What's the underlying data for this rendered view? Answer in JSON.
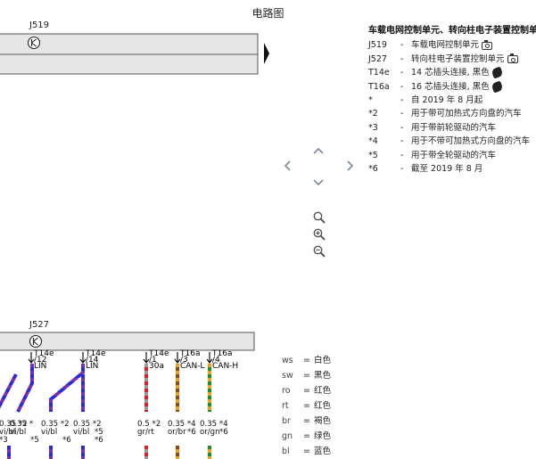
{
  "header": {
    "title": "电路图"
  },
  "legend": {
    "title": "车载电网控制单元、转向柱电子装置控制单元",
    "rows": [
      {
        "code": "J519",
        "desc": "车载电网控制单元",
        "icon": "camera-icon"
      },
      {
        "code": "J527",
        "desc": "转向柱电子装置控制单元",
        "icon": "camera-icon"
      },
      {
        "code": "T14e",
        "desc": "14 芯插头连接, 黑色",
        "icon": "connector-icon"
      },
      {
        "code": "T16a",
        "desc": "16 芯插头连接, 黑色",
        "icon": "connector-icon"
      },
      {
        "code": "*",
        "desc": "自 2019 年 8 月起"
      },
      {
        "code": "*2",
        "desc": "用于带可加热式方向盘的汽车"
      },
      {
        "code": "*3",
        "desc": "用于带前轮驱动的汽车"
      },
      {
        "code": "*4",
        "desc": "用于不带可加热式方向盘的汽车"
      },
      {
        "code": "*5",
        "desc": "用于带全轮驱动的汽车"
      },
      {
        "code": "*6",
        "desc": "截至 2019 年 8 月"
      }
    ]
  },
  "color_legend": [
    {
      "abbr": "ws",
      "name": "白色"
    },
    {
      "abbr": "sw",
      "name": "黑色"
    },
    {
      "abbr": "ro",
      "name": "红色"
    },
    {
      "abbr": "rt",
      "name": "红色"
    },
    {
      "abbr": "br",
      "name": "褐色"
    },
    {
      "abbr": "gn",
      "name": "绿色"
    },
    {
      "abbr": "bl",
      "name": "蓝色"
    }
  ],
  "diagram": {
    "top_unit": {
      "label": "J519"
    },
    "bottom_unit": {
      "label": "J527"
    },
    "pins": [
      {
        "connector": "T14e",
        "pin": "/12",
        "signal": "LIN"
      },
      {
        "connector": "T14e",
        "pin": "/14",
        "signal": "LIN"
      },
      {
        "connector": "T14e",
        "pin": "/1",
        "signal": "30a"
      },
      {
        "connector": "T16a",
        "pin": "/3",
        "signal": "CAN-L"
      },
      {
        "connector": "T16a",
        "pin": "/4",
        "signal": "CAN-H"
      }
    ],
    "wires": [
      {
        "spec": "0.35 *2",
        "color": "vi/bl",
        "note": "*3"
      },
      {
        "spec": "0.35 *",
        "color": "vi/bl",
        "note": "*5"
      },
      {
        "spec": "0.35 *2",
        "color": "vi/bl",
        "note": "*6"
      },
      {
        "spec": "0.35 *2",
        "color": "vi/bl",
        "note": "*5"
      },
      {
        "spec": "",
        "color": "",
        "note": "*6"
      },
      {
        "spec": "0.5 *2",
        "color": "gr/rt",
        "note": ""
      },
      {
        "spec": "0.35 *4",
        "color": "or/br",
        "note": "*6"
      },
      {
        "spec": "0.35 *4",
        "color": "or/gn",
        "note": "*6"
      }
    ]
  },
  "controls": {
    "pan_up": "pan-up",
    "pan_down": "pan-down",
    "pan_left": "pan-left",
    "pan_right": "pan-right",
    "zoom_fit": "zoom-fit",
    "zoom_in": "zoom-in",
    "zoom_out": "zoom-out"
  },
  "colors": {
    "unit_fill": "#e6e6e6",
    "unit_stroke": "#555555",
    "wire_violet": "#7a2fb0",
    "wire_blue": "#2a2ad8",
    "wire_red": "#e02020",
    "wire_grey": "#9a9a9a",
    "wire_orange": "#f0a020",
    "wire_brown": "#8b4a14",
    "wire_green": "#1f8f2a"
  }
}
